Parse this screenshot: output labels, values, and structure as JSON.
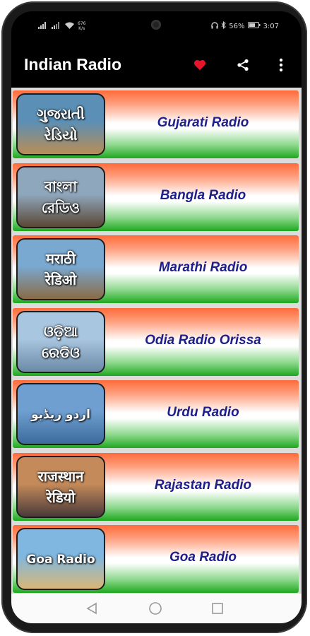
{
  "status": {
    "net_speed_top": "676",
    "net_speed_unit": "K/s",
    "battery": "56%",
    "time": "3:07"
  },
  "appbar": {
    "title": "Indian Radio",
    "favorite_icon": "heart-icon",
    "share_icon": "share-icon",
    "menu_icon": "more-vert-icon",
    "heart_color": "#e8142c"
  },
  "stations": [
    {
      "name": "Gujarati Radio",
      "thumb_text": "ગુજરાતી\nરેડિયો",
      "thumb_bg": [
        "#5b8fb5",
        "#b98d55"
      ]
    },
    {
      "name": "Bangla Radio",
      "thumb_text": "বাংলা\nরেডিও",
      "thumb_bg": [
        "#8fa7bd",
        "#5b4735"
      ]
    },
    {
      "name": "Marathi Radio",
      "thumb_text": "मराठी\nरेडिओ",
      "thumb_bg": [
        "#79a8d0",
        "#8a6b45"
      ]
    },
    {
      "name": "Odia Radio Orissa",
      "thumb_text": "ଓଡ଼ିଆ\nରେଡିଓ",
      "thumb_bg": [
        "#a9c6e0",
        "#6b8aa6"
      ]
    },
    {
      "name": "Urdu Radio",
      "thumb_text": "اردو ریڈیو",
      "thumb_bg": [
        "#6f9fd0",
        "#3c6a9c"
      ]
    },
    {
      "name": "Rajastan Radio",
      "thumb_text": "राजस्थान\nरेडियो",
      "thumb_bg": [
        "#c48a5a",
        "#4a3a3a"
      ]
    },
    {
      "name": "Goa Radio",
      "thumb_text": "Goa Radio",
      "thumb_bg": [
        "#7fb7e0",
        "#d9b777"
      ]
    }
  ],
  "navbar": {
    "back_icon": "back-triangle-icon",
    "home_icon": "home-circle-icon",
    "recents_icon": "recents-square-icon"
  }
}
